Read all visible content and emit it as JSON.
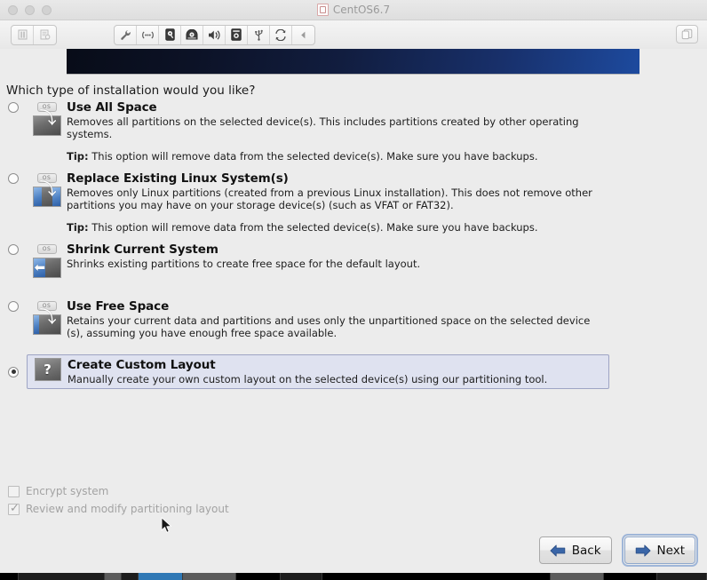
{
  "window": {
    "title": "CentOS6.7",
    "title_icon": "vm-app-icon",
    "traffic_lights": [
      "close-button",
      "minimize-button",
      "maximize-button"
    ]
  },
  "toolbar": {
    "left_buttons": [
      {
        "name": "pause-button",
        "icon": "pause-icon"
      },
      {
        "name": "snapshot-button",
        "icon": "snapshot-icon"
      }
    ],
    "device_buttons": [
      {
        "name": "settings-button",
        "icon": "wrench-icon"
      },
      {
        "name": "network-adapter-button",
        "icon": "network-icon"
      },
      {
        "name": "hard-disk-button",
        "icon": "hard-disk-icon"
      },
      {
        "name": "cd-dvd-button",
        "icon": "cd-dvd-icon"
      },
      {
        "name": "sound-card-button",
        "icon": "speaker-icon"
      },
      {
        "name": "camera-button",
        "icon": "camera-icon"
      },
      {
        "name": "usb-button",
        "icon": "usb-icon"
      },
      {
        "name": "shared-folders-button",
        "icon": "sync-icon"
      },
      {
        "name": "collapse-toolbar-button",
        "icon": "chevron-left-icon"
      }
    ],
    "right_button": {
      "name": "unity-view-button",
      "icon": "window-copy-icon"
    }
  },
  "installer": {
    "question": "Which type of installation would you like?",
    "options": [
      {
        "id": "use-all-space",
        "title": "Use All Space",
        "description": "Removes all partitions on the selected device(s).  This includes partitions created by other operating systems.",
        "tip_label": "Tip:",
        "tip": "This option will remove data from the selected device(s).  Make sure you have backups.",
        "selected": false,
        "icon": "disk-erase-all-icon",
        "icon_tag": "OS",
        "blue_left_pct": 0,
        "blue_right_pct": 0,
        "arrow": "down"
      },
      {
        "id": "replace-existing-linux",
        "title": "Replace Existing Linux System(s)",
        "description": "Removes only Linux partitions (created from a previous Linux installation).  This does not remove other partitions you may have on your storage device(s) (such as VFAT or FAT32).",
        "tip_label": "Tip:",
        "tip": "This option will remove data from the selected device(s).  Make sure you have backups.",
        "selected": false,
        "icon": "disk-replace-linux-icon",
        "icon_tag": "OS",
        "blue_left_pct": 30,
        "blue_right_pct": 30,
        "arrow": "down"
      },
      {
        "id": "shrink-current-system",
        "title": "Shrink Current System",
        "description": "Shrinks existing partitions to create free space for the default layout.",
        "tip_label": "",
        "tip": "",
        "selected": false,
        "icon": "disk-shrink-icon",
        "icon_tag": "OS",
        "blue_left_pct": 45,
        "blue_right_pct": 0,
        "arrow": "left"
      },
      {
        "id": "use-free-space",
        "title": "Use Free Space",
        "description": "Retains your current data and partitions and uses only the unpartitioned space on the selected device (s), assuming you have enough free space available.",
        "tip_label": "",
        "tip": "",
        "selected": false,
        "icon": "disk-free-space-icon",
        "icon_tag": "OS",
        "blue_left_pct": 22,
        "blue_right_pct": 0,
        "arrow": "down"
      },
      {
        "id": "create-custom-layout",
        "title": "Create Custom Layout",
        "description": "Manually create your own custom layout on the selected device(s) using our partitioning tool.",
        "tip_label": "",
        "tip": "",
        "selected": true,
        "icon": "question-mark-disk-icon",
        "icon_tag": "",
        "blue_left_pct": 0,
        "blue_right_pct": 0,
        "arrow": "none"
      }
    ],
    "checkboxes": [
      {
        "id": "encrypt-system",
        "label": "Encrypt system",
        "checked": false,
        "disabled": true
      },
      {
        "id": "review-modify-partitioning",
        "label": "Review and modify partitioning layout",
        "checked": true,
        "disabled": true
      }
    ],
    "buttons": {
      "back": {
        "label": "Back",
        "icon": "arrow-left-icon",
        "focused": false
      },
      "next": {
        "label": "Next",
        "icon": "arrow-right-icon",
        "focused": true
      }
    }
  },
  "colors": {
    "banner_start": "#080c18",
    "banner_end": "#1d4a9e",
    "selection_bg": "#dfe2f0",
    "selection_border": "#9ea4c4",
    "accent_blue": "#2d5fa6",
    "page_bg": "#ececec"
  }
}
